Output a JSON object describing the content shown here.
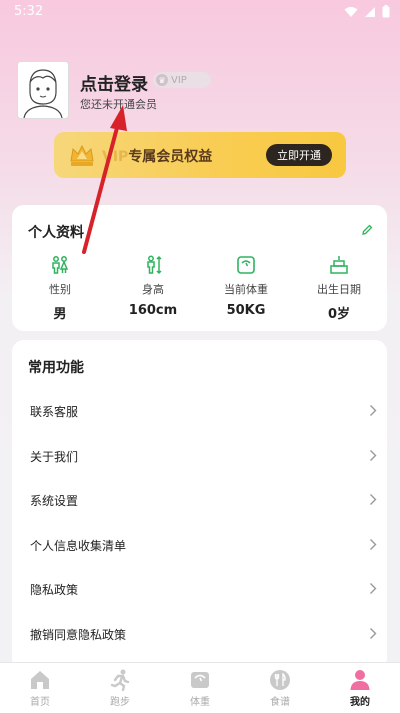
{
  "status_bar": {
    "time": "5:32"
  },
  "user": {
    "login_label": "点击登录",
    "vip_badge": "VIP",
    "membership_status": "您还未开通会员"
  },
  "vip_banner": {
    "title_vip": "VIP",
    "title_rest": "专属会员权益",
    "button": "立即开通"
  },
  "profile": {
    "title": "个人资料",
    "stats": [
      {
        "label": "性别",
        "value": "男",
        "icon": "gender-icon"
      },
      {
        "label": "身高",
        "value": "160cm",
        "icon": "height-icon"
      },
      {
        "label": "当前体重",
        "value": "50KG",
        "icon": "scale-icon"
      },
      {
        "label": "出生日期",
        "value": "0岁",
        "icon": "cake-icon"
      }
    ]
  },
  "functions": {
    "title": "常用功能",
    "items": [
      "联系客服",
      "关于我们",
      "系统设置",
      "个人信息收集清单",
      "隐私政策",
      "撤销同意隐私政策"
    ]
  },
  "tabbar": {
    "tabs": [
      {
        "label": "首页",
        "icon": "home-icon"
      },
      {
        "label": "跑步",
        "icon": "running-icon"
      },
      {
        "label": "体重",
        "icon": "scale-icon"
      },
      {
        "label": "食谱",
        "icon": "utensils-icon"
      },
      {
        "label": "我的",
        "icon": "person-icon"
      }
    ],
    "active_index": 4
  },
  "colors": {
    "accent_green": "#2fb35f",
    "active_pink": "#f06ea0",
    "vip_gold": "#f9cd54",
    "annotation_arrow": "#d8222a"
  }
}
